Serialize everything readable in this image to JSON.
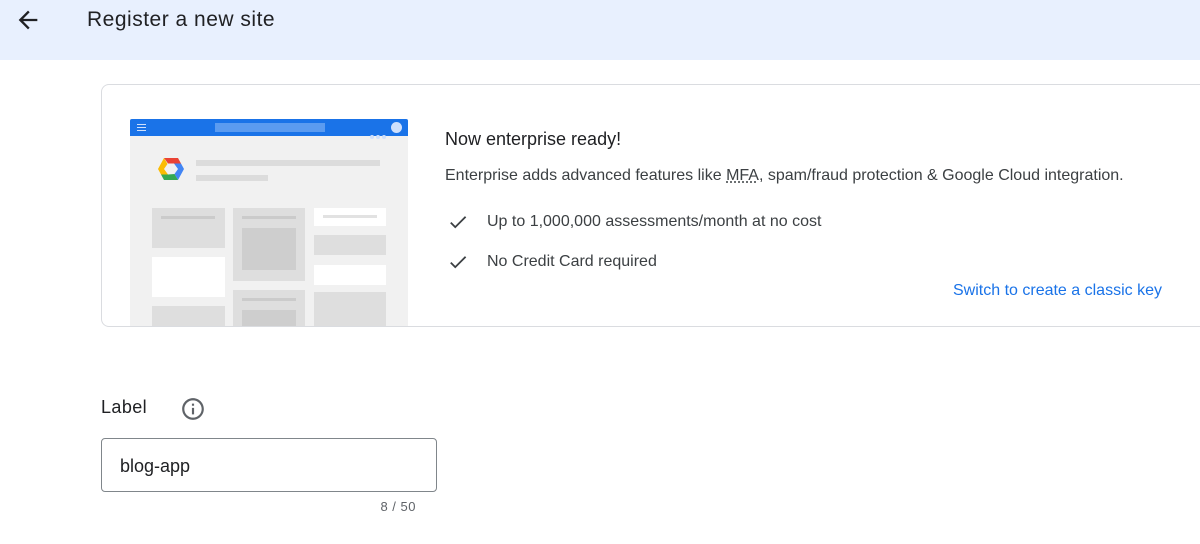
{
  "header": {
    "back_icon": "arrow-back-icon",
    "title": "Register a new site"
  },
  "promo": {
    "headline": "Now enterprise ready!",
    "description_before": "Enterprise adds advanced features like ",
    "description_abbr": "MFA",
    "description_after": ", spam/fraud protection & Google Cloud integration.",
    "benefits": [
      "Up to 1,000,000 assessments/month at no cost",
      "No Credit Card required"
    ],
    "classic_link": "Switch to create a classic key",
    "illustration_icon": "google-cloud-logo-icon"
  },
  "form": {
    "label": "Label",
    "info_icon": "info-icon",
    "label_value": "blog-app",
    "counter": "8 / 50"
  },
  "colors": {
    "header_bg": "#e8f0fe",
    "accent": "#1a73e8",
    "border": "#dadce0"
  }
}
